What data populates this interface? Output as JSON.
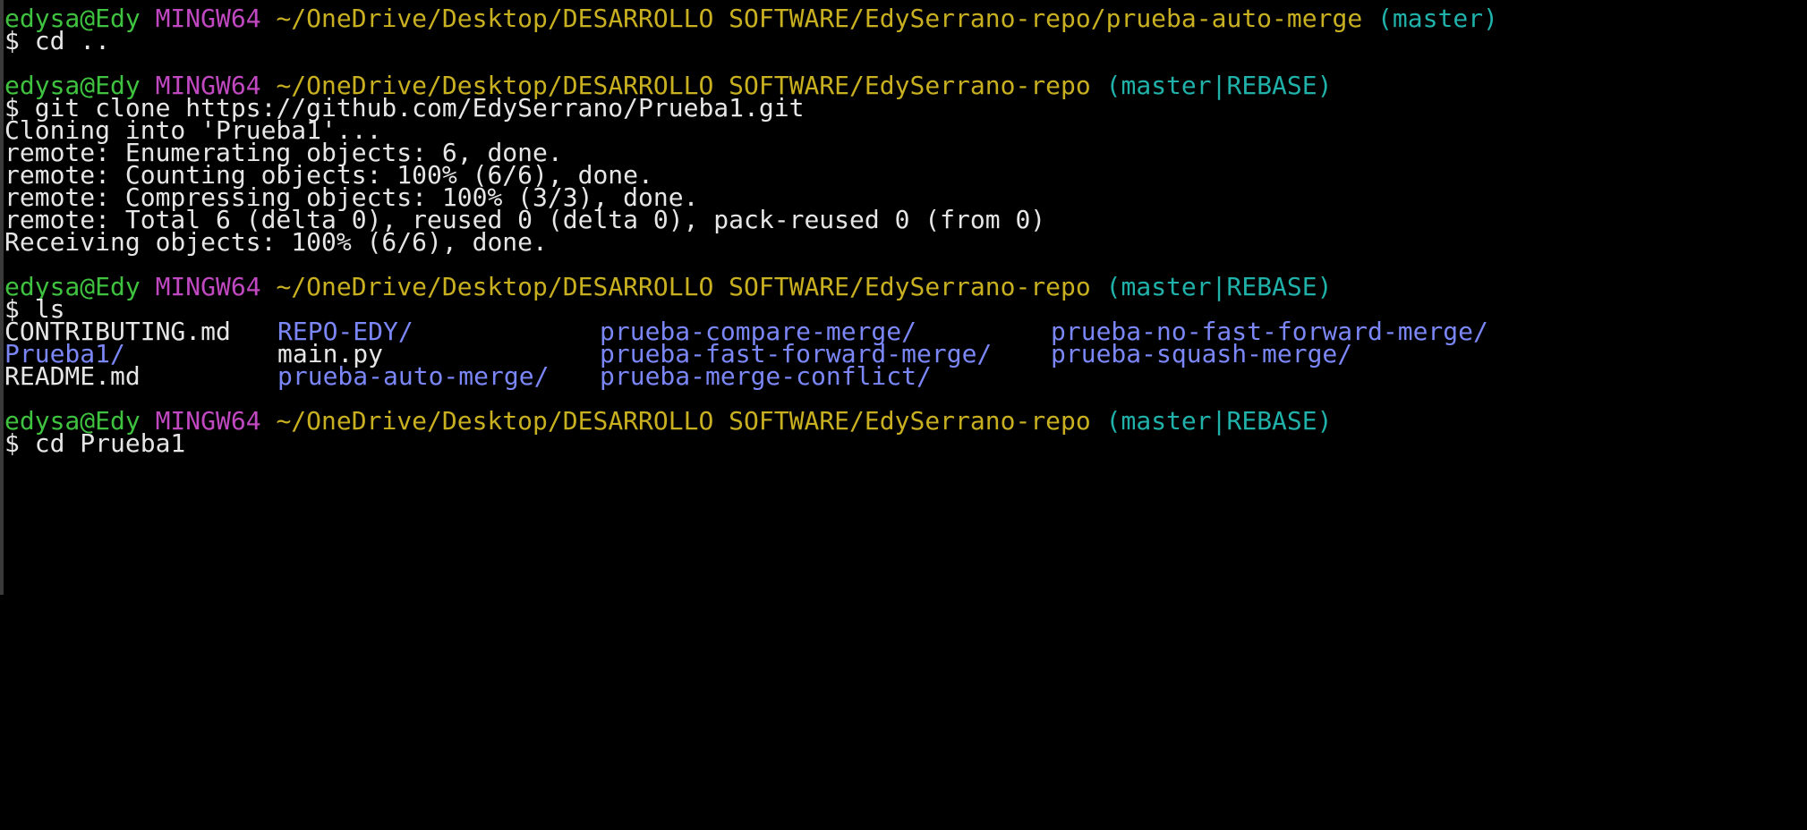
{
  "prompts": [
    {
      "user": "edysa@Edy",
      "system": "MINGW64",
      "path": "~/OneDrive/Desktop/DESARROLLO SOFTWARE/EdySerrano-repo/prueba-auto-merge",
      "branch": "(master)",
      "command": "$ cd .."
    },
    {
      "user": "edysa@Edy",
      "system": "MINGW64",
      "path": "~/OneDrive/Desktop/DESARROLLO SOFTWARE/EdySerrano-repo",
      "branch": "(master|REBASE)",
      "command": "$ git clone https://github.com/EdySerrano/Prueba1.git"
    },
    {
      "user": "edysa@Edy",
      "system": "MINGW64",
      "path": "~/OneDrive/Desktop/DESARROLLO SOFTWARE/EdySerrano-repo",
      "branch": "(master|REBASE)",
      "command": "$ ls"
    },
    {
      "user": "edysa@Edy",
      "system": "MINGW64",
      "path": "~/OneDrive/Desktop/DESARROLLO SOFTWARE/EdySerrano-repo",
      "branch": "(master|REBASE)",
      "command": "$ cd Prueba1"
    }
  ],
  "clone_output": [
    "Cloning into 'Prueba1'...",
    "remote: Enumerating objects: 6, done.",
    "remote: Counting objects: 100% (6/6), done.",
    "remote: Compressing objects: 100% (3/3), done.",
    "remote: Total 6 (delta 0), reused 0 (delta 0), pack-reused 0 (from 0)",
    "Receiving objects: 100% (6/6), done."
  ],
  "ls_output": [
    [
      {
        "name": "CONTRIBUTING.md",
        "type": "file"
      },
      {
        "name": "REPO-EDY/",
        "type": "dir"
      },
      {
        "name": "prueba-compare-merge/",
        "type": "dir"
      },
      {
        "name": "prueba-no-fast-forward-merge/",
        "type": "dir"
      }
    ],
    [
      {
        "name": "Prueba1/",
        "type": "dir"
      },
      {
        "name": "main.py",
        "type": "file"
      },
      {
        "name": "prueba-fast-forward-merge/",
        "type": "dir"
      },
      {
        "name": "prueba-squash-merge/",
        "type": "dir"
      }
    ],
    [
      {
        "name": "README.md",
        "type": "file"
      },
      {
        "name": "prueba-auto-merge/",
        "type": "dir"
      },
      {
        "name": "prueba-merge-conflict/",
        "type": "dir"
      },
      {
        "name": "",
        "type": "file"
      }
    ]
  ],
  "colors": {
    "background": "#000000",
    "text": "#e6e6e6",
    "user": "#3fc23f",
    "system": "#c048c0",
    "path": "#c8b020",
    "branch": "#20b2aa",
    "directory": "#7b86f7"
  }
}
